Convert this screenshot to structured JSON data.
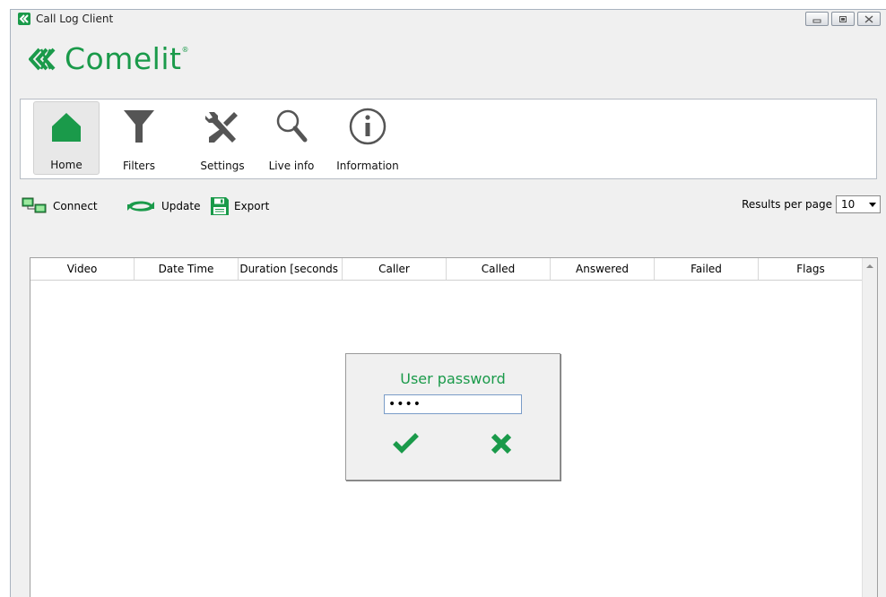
{
  "window": {
    "title": "Call Log Client",
    "controls": [
      "minimize-icon",
      "restore-icon",
      "close-icon"
    ]
  },
  "logo": {
    "text": "Comelit",
    "mark": "®"
  },
  "ribbon": {
    "buttons": [
      {
        "label": "Home",
        "icon": "home-icon",
        "active": true
      },
      {
        "label": "Filters",
        "icon": "filter-icon"
      },
      {
        "label": "Settings",
        "icon": "settings-icon"
      },
      {
        "label": "Live info",
        "icon": "search-icon"
      },
      {
        "label": "Information",
        "icon": "info-icon"
      }
    ]
  },
  "toolbar": {
    "connect_label": "Connect",
    "update_label": "Update",
    "export_label": "Export",
    "results_per_page_label": "Results per page",
    "results_per_page_value": "10"
  },
  "table": {
    "columns": [
      "Video",
      "Date Time",
      "Duration [seconds",
      "Caller",
      "Called",
      "Answered",
      "Failed",
      "Flags"
    ],
    "rows": []
  },
  "dialog": {
    "title": "User password",
    "password_value": "••••"
  },
  "colors": {
    "accent": "#1a9a4a",
    "icon_gray": "#555555"
  }
}
